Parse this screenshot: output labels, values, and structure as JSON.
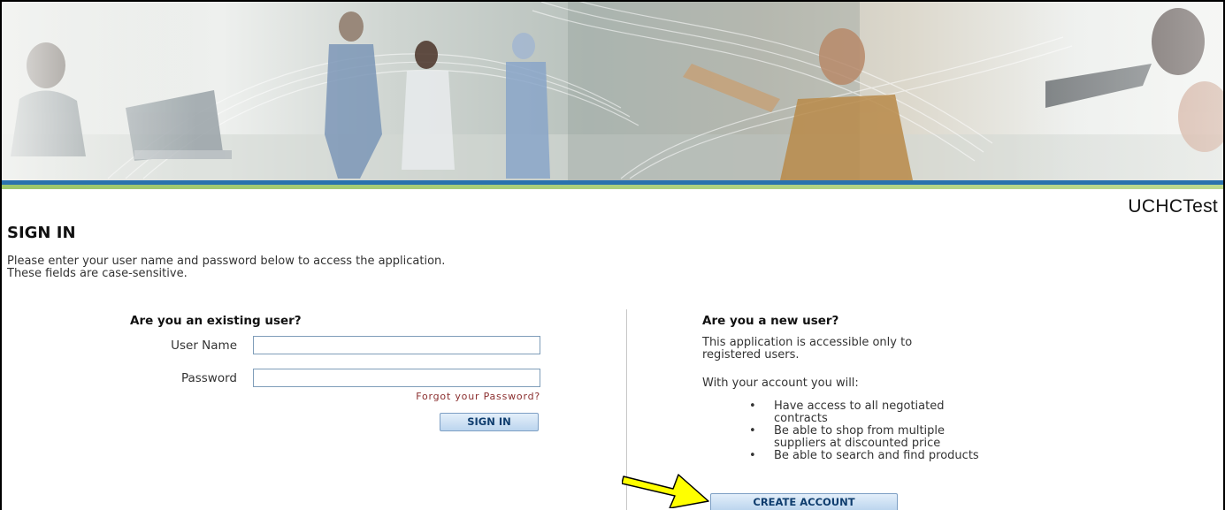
{
  "banner": {
    "image_name": "banner-photo-medical-staff"
  },
  "header": {
    "brand": "UCHCTest",
    "title": "SIGN IN",
    "intro_line1": "Please enter your user name and password below to access the application.",
    "intro_line2": "These fields are case-sensitive."
  },
  "existing_user": {
    "heading": "Are you an existing user?",
    "username_label": "User Name",
    "username_value": "",
    "password_label": "Password",
    "password_value": "",
    "forgot_link": "Forgot your Password?",
    "sign_in_button": "SIGN IN"
  },
  "new_user": {
    "heading": "Are you a new user?",
    "desc_line1": "This application is accessible only to",
    "desc_line2": "registered users.",
    "benefits_intro": "With your account you will:",
    "benefits": [
      {
        "line1": "Have access to all negotiated",
        "line2": "contracts"
      },
      {
        "line1": "Be able to shop from multiple",
        "line2": "suppliers at discounted price"
      },
      {
        "line1": "Be able to search and find products",
        "line2": ""
      }
    ],
    "create_account_button": "CREATE ACCOUNT"
  },
  "colors": {
    "stripe_blue": "#2a72ad",
    "stripe_green": "#9cc66a",
    "button_text": "#0f3d6e",
    "link": "#8b2f2f",
    "arrow_fill": "#ffff00"
  },
  "annotation": {
    "icon": "yellow-arrow-icon"
  }
}
